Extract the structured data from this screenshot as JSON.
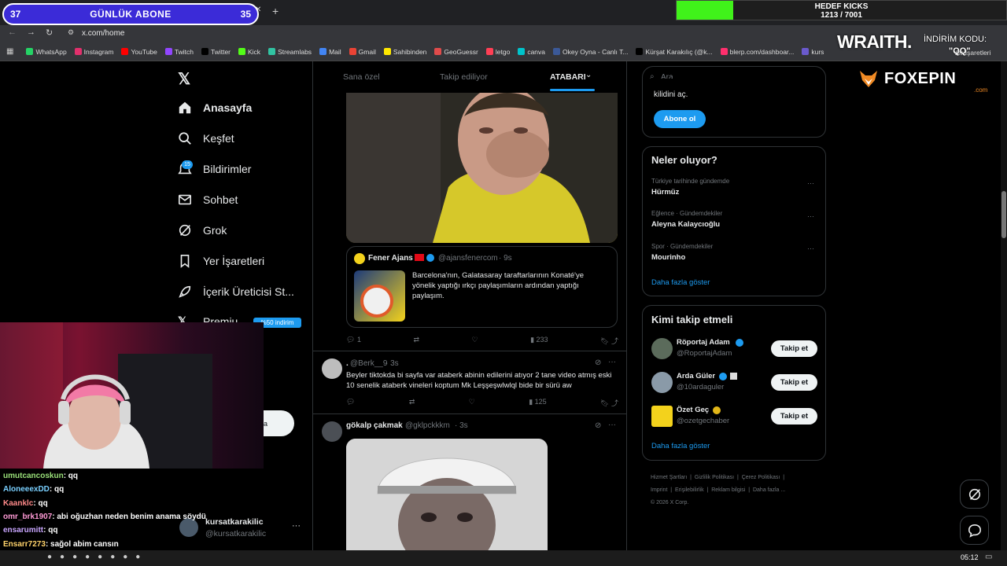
{
  "overlay": {
    "sub_left_count": "37",
    "sub_title": "GÜNLÜK ABONE",
    "sub_right_count": "35",
    "goal_title": "HEDEF KICKS",
    "goal_progress": "1213 / 7001",
    "goal_fraction": 0.173,
    "sponsor_wraith": "WRAITH.",
    "discount_label": "İNDİRİM KODU:",
    "discount_code": "\"QQ\"",
    "sponsor_foxepin": "FOXEPIN",
    "sponsor_foxepin_sub": ".com"
  },
  "browser": {
    "url": "x.com/home",
    "bookmarks": [
      {
        "label": "WhatsApp",
        "color": "#25d366"
      },
      {
        "label": "Instagram",
        "color": "#e1306c"
      },
      {
        "label": "YouTube",
        "color": "#ff0000"
      },
      {
        "label": "Twitch",
        "color": "#9146ff"
      },
      {
        "label": "Twitter",
        "color": "#000000"
      },
      {
        "label": "Kick",
        "color": "#53fc18"
      },
      {
        "label": "Streamlabs",
        "color": "#31c3a2"
      },
      {
        "label": "Mail",
        "color": "#4285f4"
      },
      {
        "label": "Gmail",
        "color": "#ea4335"
      },
      {
        "label": "Sahibinden",
        "color": "#ffe800"
      },
      {
        "label": "GeoGuessr",
        "color": "#e04b4b"
      },
      {
        "label": "letgo",
        "color": "#ff3f55"
      },
      {
        "label": "canva",
        "color": "#00c4cc"
      },
      {
        "label": "Okey Oyna - Canlı T...",
        "color": "#3b5998"
      },
      {
        "label": "Kürşat Karakılıç (@k...",
        "color": "#000000"
      },
      {
        "label": "blerp.com/dashboar...",
        "color": "#ff2f6d"
      },
      {
        "label": "kurs",
        "color": "#6a5acd"
      }
    ],
    "bookmarks_right": "Yer İşaretleri"
  },
  "nav": {
    "items": [
      {
        "label": "Anasayfa"
      },
      {
        "label": "Keşfet"
      },
      {
        "label": "Bildirimler"
      },
      {
        "label": "Sohbet"
      },
      {
        "label": "Grok"
      },
      {
        "label": "Yer İşaretleri"
      },
      {
        "label": "İçerik Üreticisi St..."
      },
      {
        "label": "Premiu"
      }
    ],
    "notif_badge": "15",
    "premium_badge": "%50 indirim",
    "post_button_partial": "a",
    "account_name": "kursatkarakilic",
    "account_handle": "@kursatkarakilic",
    "account_more": "···"
  },
  "feed": {
    "tabs": [
      "Sana özel",
      "Takip ediliyor",
      "ATABARI"
    ],
    "quote": {
      "name": "Fener Ajans",
      "handle": "@ajansfenercom",
      "time": "· 9s",
      "text": "Barcelona'nın, Galatasaray taraftarlarının Konaté'ye yönelik yaptığı ırkçı paylaşımların ardından yaptığı paylaşım."
    },
    "post1_stats": {
      "replies": "1",
      "views": "233"
    },
    "post2": {
      "name": ".",
      "handle": "@Berk__9",
      "time": "· 3s",
      "text": "Beyler tiktokda bi sayfa var ataberk abinin edilerini atıyor 2 tane video atmış eski 10 senelik ataberk vineleri koptum Mk Leşşeşwlwlql bide bir sürü aw",
      "views": "125"
    },
    "post3": {
      "name": "gökalp çakmak",
      "handle": "@gklpckkkm",
      "time": "· 3s"
    }
  },
  "right": {
    "search_placeholder": "Ara",
    "premium_text": "kilidini aç.",
    "subscribe_btn": "Abone ol",
    "trends_title": "Neler oluyor?",
    "trends": [
      {
        "context": "Türkiye tarihinde gündemde",
        "name": "Hürmüz"
      },
      {
        "context": "Eğlence · Gündemdekiler",
        "name": "Aleyna Kalaycıoğlu"
      },
      {
        "context": "Spor · Gündemdekiler",
        "name": "Mourinho"
      }
    ],
    "show_more": "Daha fazla göster",
    "follow_title": "Kimi takip etmeli",
    "follow": [
      {
        "name": "Röportaj Adam",
        "handle": "@RoportajAdam",
        "button": "Takip et"
      },
      {
        "name": "Arda Güler",
        "handle": "@10ardaguler",
        "button": "Takip et"
      },
      {
        "name": "Özet Geç",
        "handle": "@ozetgechaber",
        "button": "Takip et"
      }
    ],
    "show_more2": "Daha fazla göster",
    "footer_links": [
      "Hizmet Şartları",
      "Gizlilik Politikası",
      "Çerez Politikası",
      "Imprint",
      "Erişilebilirlik",
      "Reklam bilgisi",
      "Daha fazla ..."
    ],
    "copyright": "© 2026 X Corp."
  },
  "chat": [
    {
      "user": "umutcancoskun",
      "msg": ": qq",
      "color": "#9be27a"
    },
    {
      "user": "AloneeexDD",
      "msg": ": qq",
      "color": "#7ad0ff"
    },
    {
      "user": "Kaanklc",
      "msg": ": qq",
      "color": "#ff8a8a"
    },
    {
      "user": "omr_brk1907",
      "msg": ": abi oğuzhan neden benim anama söydü",
      "color": "#ff9ad5"
    },
    {
      "user": "ensarumitt",
      "msg": ": qq",
      "color": "#c9a6ff"
    },
    {
      "user": "Ensarr7273",
      "msg": ": sağol abim cansın",
      "color": "#ffd36b"
    }
  ],
  "taskbar": {
    "time": "05:12"
  }
}
